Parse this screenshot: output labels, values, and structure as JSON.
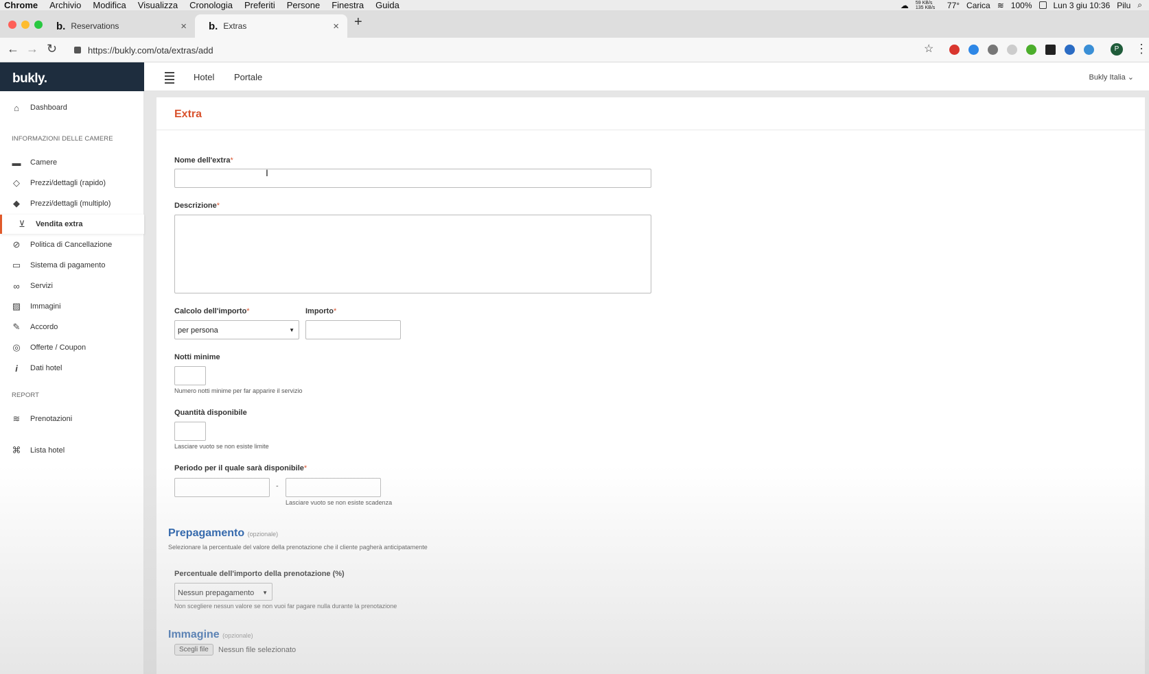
{
  "menubar": {
    "app": "Chrome",
    "items": [
      "Archivio",
      "Modifica",
      "Visualizza",
      "Cronologia",
      "Preferiti",
      "Persone",
      "Finestra",
      "Guida"
    ],
    "status": {
      "network": "59 KB/s 135 KB/s",
      "temp": "77°",
      "power_label": "Carica",
      "battery": "100%",
      "datetime": "Lun 3 giu 10:36",
      "user": "Pilu"
    }
  },
  "browser": {
    "tabs": [
      {
        "favicon": "b.",
        "title": "Reservations"
      },
      {
        "favicon": "b.",
        "title": "Extras"
      }
    ],
    "new_tab": "+",
    "url": "https://bukly.com/ota/extras/add",
    "profile_initial": "P"
  },
  "app": {
    "brand": "bukly.",
    "topnav": [
      "Hotel",
      "Portale"
    ],
    "user_menu": "Bukly Italia",
    "colors": {
      "accent": "#d9532e",
      "brand_bg": "#1e2d3e",
      "section_blue": "#1d5aa8"
    }
  },
  "sidebar": {
    "dashboard": "Dashboard",
    "section1": "INFORMAZIONI DELLE CAMERE",
    "items": [
      {
        "icon": "bed-icon",
        "label": "Camere"
      },
      {
        "icon": "tag-outline-icon",
        "label": "Prezzi/dettagli (rapido)"
      },
      {
        "icon": "tags-icon",
        "label": "Prezzi/dettagli (multiplo)"
      },
      {
        "icon": "cart-icon",
        "label": "Vendita extra"
      },
      {
        "icon": "ban-icon",
        "label": "Politica di Cancellazione"
      },
      {
        "icon": "credit-card-icon",
        "label": "Sistema di pagamento"
      },
      {
        "icon": "binoculars-icon",
        "label": "Servizi"
      },
      {
        "icon": "image-icon",
        "label": "Immagini"
      },
      {
        "icon": "pen-icon",
        "label": "Accordo"
      },
      {
        "icon": "target-icon",
        "label": "Offerte / Coupon"
      },
      {
        "icon": "info-icon",
        "label": "Dati hotel"
      }
    ],
    "section2": "REPORT",
    "report_items": [
      {
        "icon": "layers-icon",
        "label": "Prenotazioni"
      }
    ],
    "hotel_list": "Lista hotel"
  },
  "form": {
    "title": "Extra",
    "name_label": "Nome dell'extra",
    "description_label": "Descrizione",
    "calc_label": "Calcolo dell'importo",
    "calc_value": "per persona",
    "amount_label": "Importo",
    "min_nights_label": "Notti minime",
    "min_nights_help": "Numero notti minime per far apparire il servizio",
    "quantity_label": "Quantità disponibile",
    "quantity_help": "Lasciare vuoto se non esiste limite",
    "period_label": "Periodo per il quale sarà disponibile",
    "period_separator": "-",
    "period_help": "Lasciare vuoto se non esiste scadenza",
    "required_mark": "*"
  },
  "prepayment": {
    "title": "Prepagamento",
    "optional": "(opzionale)",
    "description": "Selezionare la percentuale del valore della prenotazione che il cliente pagherà anticipatamente",
    "percent_label": "Percentuale dell'importo della prenotazione (%)",
    "percent_value": "Nessun prepagamento",
    "percent_help": "Non scegliere nessun valore se non vuoi far pagare nulla durante la prenotazione"
  },
  "image": {
    "title": "Immagine",
    "optional": "(opzionale)",
    "choose_button": "Scegli file",
    "no_file": "Nessun file selezionato"
  }
}
